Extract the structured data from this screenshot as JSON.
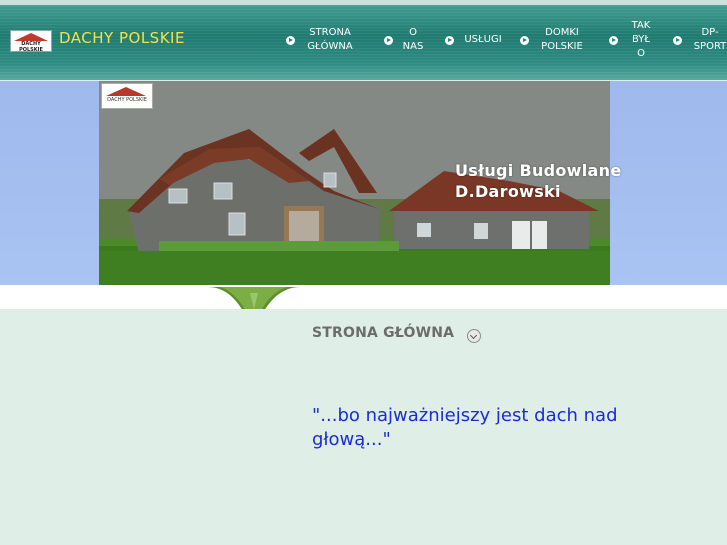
{
  "header": {
    "logo_text": "DACHY POLSKIE",
    "site_title": "DACHY POLSKIE",
    "nav": [
      {
        "label": "STRONA\nGŁÓWNA"
      },
      {
        "label": "O\nNAS"
      },
      {
        "label": "USŁUGI"
      },
      {
        "label": "DOMKI\nPOLSKIE"
      },
      {
        "label": "TAK\nBYŁ\nO"
      },
      {
        "label": "DP-\nSPORT"
      }
    ]
  },
  "banner": {
    "photo_logo_text": "DACHY POLSKIE",
    "title_line1": "Usługi Budowlane",
    "title_line2": "D.Darowski"
  },
  "content": {
    "section_title": "STRONA GŁÓWNA",
    "quote": "\"...bo najważniejszy jest dach nad głową...\""
  },
  "colors": {
    "header_teal": "#1f7a70",
    "title_yellow": "#f3e34a",
    "quote_blue": "#1a2cd6",
    "content_bg": "#dfeee6"
  }
}
